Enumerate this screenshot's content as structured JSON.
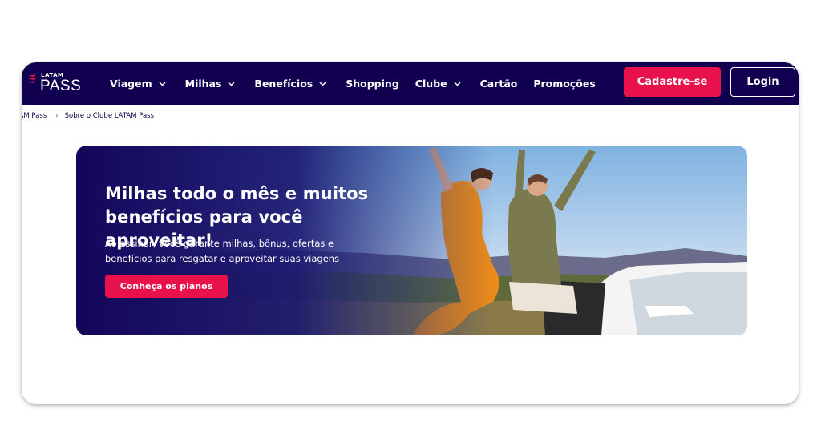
{
  "brand": {
    "logo_small": "LATAM",
    "logo_big": "PASS",
    "colors": {
      "navy": "#10004f",
      "accent": "#e8114b"
    }
  },
  "nav": {
    "items": [
      {
        "label": "Viagem",
        "has_dropdown": true
      },
      {
        "label": "Milhas",
        "has_dropdown": true
      },
      {
        "label": "Benefícios",
        "has_dropdown": true
      },
      {
        "label": "Shopping",
        "has_dropdown": false
      },
      {
        "label": "Clube",
        "has_dropdown": true
      },
      {
        "label": "Cartão",
        "has_dropdown": false
      },
      {
        "label": "Promoções",
        "has_dropdown": false
      }
    ],
    "signup_label": "Cadastre-se",
    "login_label": "Login"
  },
  "breadcrumb": {
    "items": [
      "TAM Pass",
      "Sobre o Clube LATAM Pass"
    ]
  },
  "banner": {
    "title": "Milhas todo o mês e muitos benefícios para você aproveitar!",
    "subtitle": "Ao assinar, você garante milhas, bônus, ofertas e benefícios para resgatar e aproveitar suas viagens",
    "cta_label": "Conheça os planos"
  }
}
